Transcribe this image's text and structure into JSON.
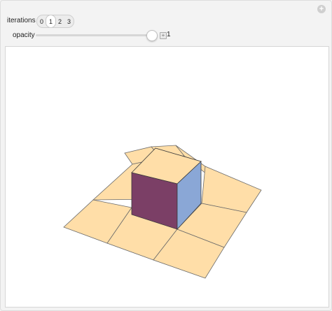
{
  "controls": {
    "iterations": {
      "label": "iterations",
      "options": [
        "0",
        "1",
        "2",
        "3"
      ],
      "selected": "1"
    },
    "opacity": {
      "label": "opacity",
      "value": 1,
      "value_text": "1",
      "min": 0,
      "max": 1
    }
  },
  "colors": {
    "tile_fill": "#ffdea8",
    "tile_edge": "#6a6a6a",
    "cube_front": "#7b3f66",
    "cube_side": "#8aa7d6",
    "cube_top": "#ffdea8"
  },
  "icons": {
    "add": "plus-icon",
    "expand": "expand-icon"
  }
}
